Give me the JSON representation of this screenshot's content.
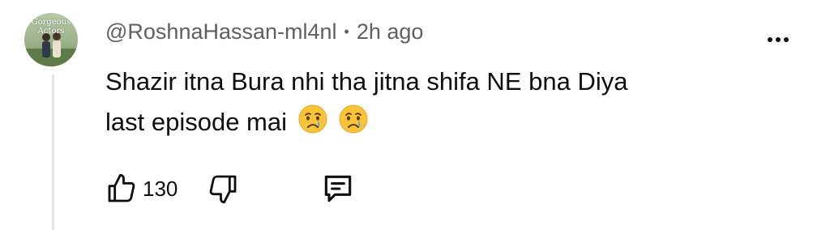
{
  "comment": {
    "avatar_text": "Gorgeous Actors",
    "author": "@RoshnaHassan-ml4nl",
    "separator": "•",
    "time": "2h ago",
    "text_line1": "Shazir itna Bura nhi tha jitna shifa NE bna Diya",
    "text_line2": "last episode mai",
    "emojis": [
      "crying-face",
      "crying-face"
    ],
    "likes": "130"
  },
  "icons": {
    "menu": "more-vert-icon",
    "like": "thumbs-up-icon",
    "dislike": "thumbs-down-icon",
    "reply": "reply-icon"
  }
}
